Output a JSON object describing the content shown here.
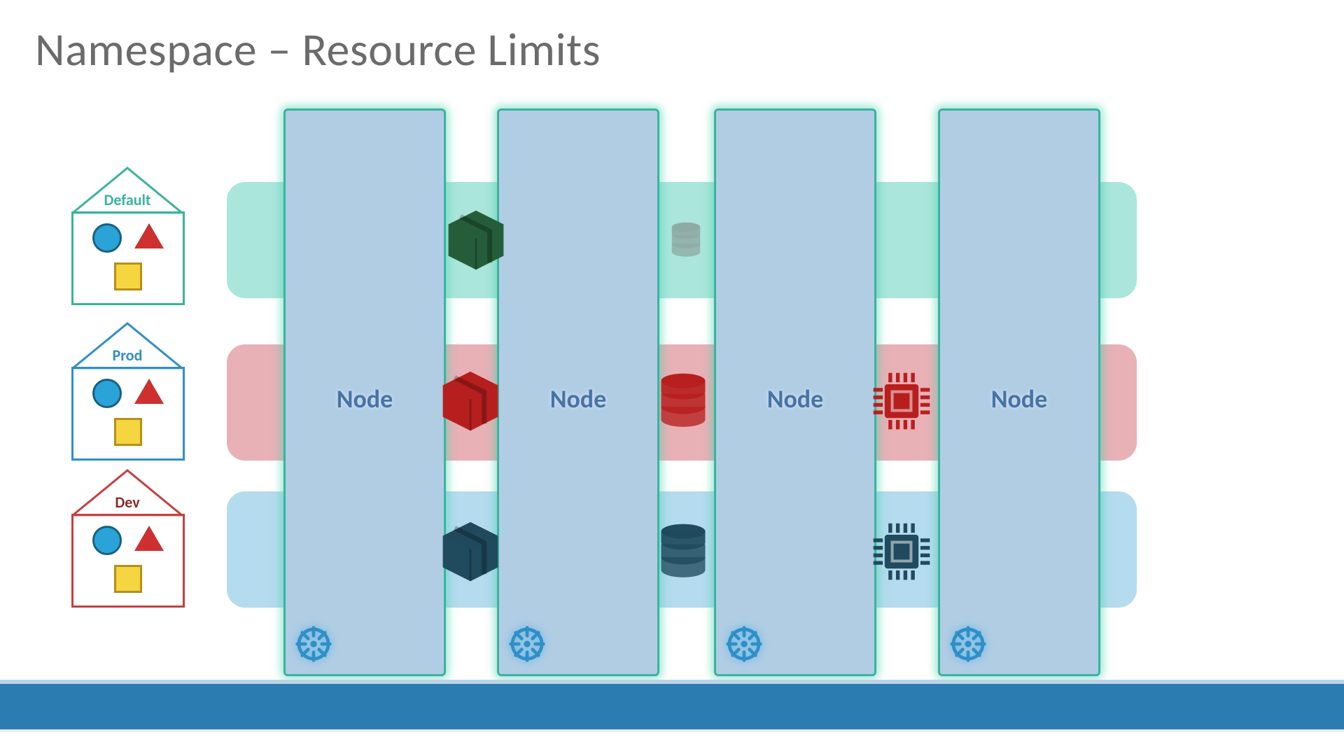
{
  "title": "Namespace – Resource Limits",
  "house": {
    "default": {
      "label": "Default",
      "color": "#3ab39f",
      "text": "#3ab39f"
    },
    "prod": {
      "label": "Prod",
      "color": "#2f8fc6",
      "text": "#2f8fc6"
    },
    "dev": {
      "label": "Dev",
      "color": "#c63f3f",
      "text": "#8a2929"
    }
  },
  "nodes": {
    "label": "Node",
    "positions": [
      405,
      710,
      1020,
      1340
    ]
  },
  "lanes": {
    "default": {
      "name": "Default",
      "color_hint": "#66d4bd"
    },
    "prod": {
      "name": "Prod",
      "color_hint": "#d46b73"
    },
    "dev": {
      "name": "Dev",
      "color_hint": "#79bde1"
    }
  },
  "resources": {
    "default": [
      {
        "icon": "box",
        "col": 0,
        "tint": "#255d3a"
      },
      {
        "icon": "db",
        "col": 1,
        "tint": "#7a7a7a"
      }
    ],
    "prod": [
      {
        "icon": "box",
        "col": 0,
        "tint": "#b71f1f"
      },
      {
        "icon": "db",
        "col": 1,
        "tint": "#b71f1f"
      },
      {
        "icon": "cpu",
        "col": 2,
        "tint": "#b71f1f"
      }
    ],
    "dev": [
      {
        "icon": "box",
        "col": 0,
        "tint": "#204a5e"
      },
      {
        "icon": "db",
        "col": 1,
        "tint": "#204a5e"
      },
      {
        "icon": "cpu",
        "col": 2,
        "tint": "#204a5e"
      }
    ]
  },
  "footer_color": "#2b7db1"
}
